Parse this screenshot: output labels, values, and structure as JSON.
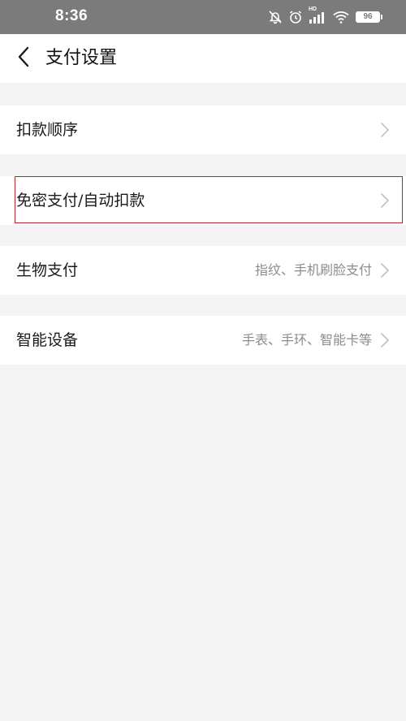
{
  "status_bar": {
    "time": "8:36",
    "battery_level": "96",
    "signal_tag": "HD",
    "icons": [
      "mute-bell-icon",
      "alarm-clock-icon",
      "signal-icon",
      "wifi-icon",
      "battery-icon"
    ]
  },
  "header": {
    "back_icon": "chevron-left-icon",
    "title": "支付设置"
  },
  "rows": [
    {
      "label": "扣款顺序",
      "detail": ""
    },
    {
      "label": "免密支付/自动扣款",
      "detail": "",
      "highlighted": true,
      "highlight_color": "#b3262d"
    },
    {
      "label": "生物支付",
      "detail": "指纹、手机刷脸支付"
    },
    {
      "label": "智能设备",
      "detail": "手表、手环、智能卡等"
    }
  ],
  "colors": {
    "status_bar_bg": "#7b7b7b",
    "page_bg": "#f4f4f4",
    "row_bg": "#ffffff",
    "detail_text": "#8c8c8c",
    "chevron": "#c4c4c4"
  }
}
